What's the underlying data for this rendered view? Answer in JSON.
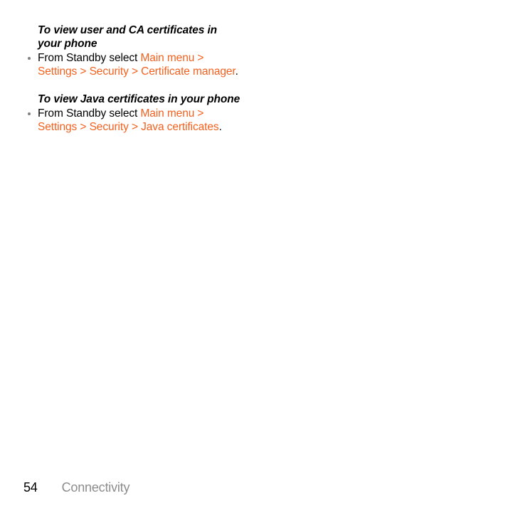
{
  "document": {
    "page_number": "54",
    "section_name": "Connectivity",
    "colors": {
      "path_reference": "#F4601E",
      "body_text": "#000000",
      "footer_section": "#8C8C8C",
      "bullet_marker": "#808080",
      "background": "#FFFFFF"
    }
  },
  "sections": [
    {
      "heading": "To view user and CA certificates in your phone",
      "bullets": [
        {
          "lead_text": "From Standby select ",
          "path_reference": "Main menu > Settings > Security > Certificate manager",
          "trailing_text": "."
        }
      ]
    },
    {
      "heading": "To view Java certificates in your phone",
      "bullets": [
        {
          "lead_text": "From Standby select ",
          "path_reference": "Main menu > Settings > Security > Java certificates",
          "trailing_text": "."
        }
      ]
    }
  ]
}
